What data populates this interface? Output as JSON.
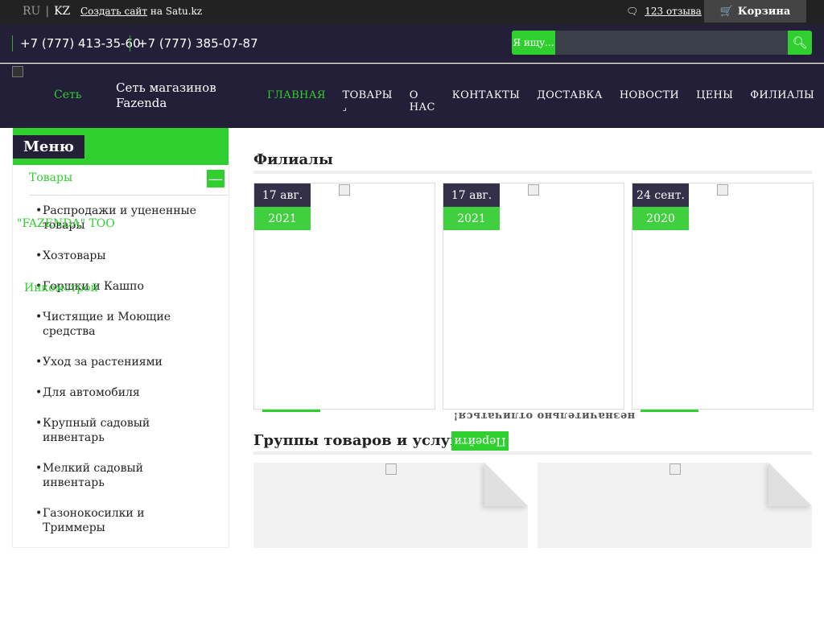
{
  "topbar": {
    "lang_ru": "RU",
    "lang_sep": "|",
    "lang_kz": "KZ",
    "create_link": "Создать сайт",
    "create_suffix": "на Satu.kz",
    "reviews": "123 отзыва",
    "cart": "Корзина"
  },
  "contacts": {
    "phone1": "+7 (777) 413-35-60",
    "phone2": "+7 (777) 385-07-87"
  },
  "search": {
    "label": "Я ищу...",
    "placeholder": ""
  },
  "header": {
    "logo_text": "Сеть",
    "slogan_line1": "Сеть магазинов",
    "slogan_line2": "Fazenda"
  },
  "nav": {
    "items": [
      "ГЛАВНАЯ",
      "ТОВАРЫ",
      "О НАС",
      "КОНТАКТЫ",
      "ДОСТАВКА",
      "НОВОСТИ",
      "ЦЕНЫ",
      "ФИЛИАЛЫ"
    ],
    "dropdown_glyph": "⌟"
  },
  "sidebar": {
    "title": "Меню",
    "category": "Товары",
    "toggle": "—",
    "items": [
      "Распродажи и уцененные товары",
      "Хозтовары",
      "Горшки и Кашпо",
      "Чистящие и Моющие средства",
      "Уход за растениями",
      "Для автомобиля",
      "Крупный садовый инвентарь",
      "Мелкий садовый инвентарь",
      "Газонокосилки и Триммеры"
    ],
    "overlay1": "\"FAZENDA\" ТОО",
    "overlay2": "Инкомстрой"
  },
  "main": {
    "branches_title": "Филиалы",
    "cards": [
      {
        "date": "17 авг.",
        "year": "2021"
      },
      {
        "date": "17 авг.",
        "year": "2021"
      },
      {
        "date": "24 сент.",
        "year": "2020"
      }
    ],
    "mirror_text": "незначительно отличаться!",
    "groups_title": "Группы товаров и услуг",
    "goto": "Перейти"
  },
  "colors": {
    "accent": "#30cf30",
    "dark": "#241f38"
  }
}
